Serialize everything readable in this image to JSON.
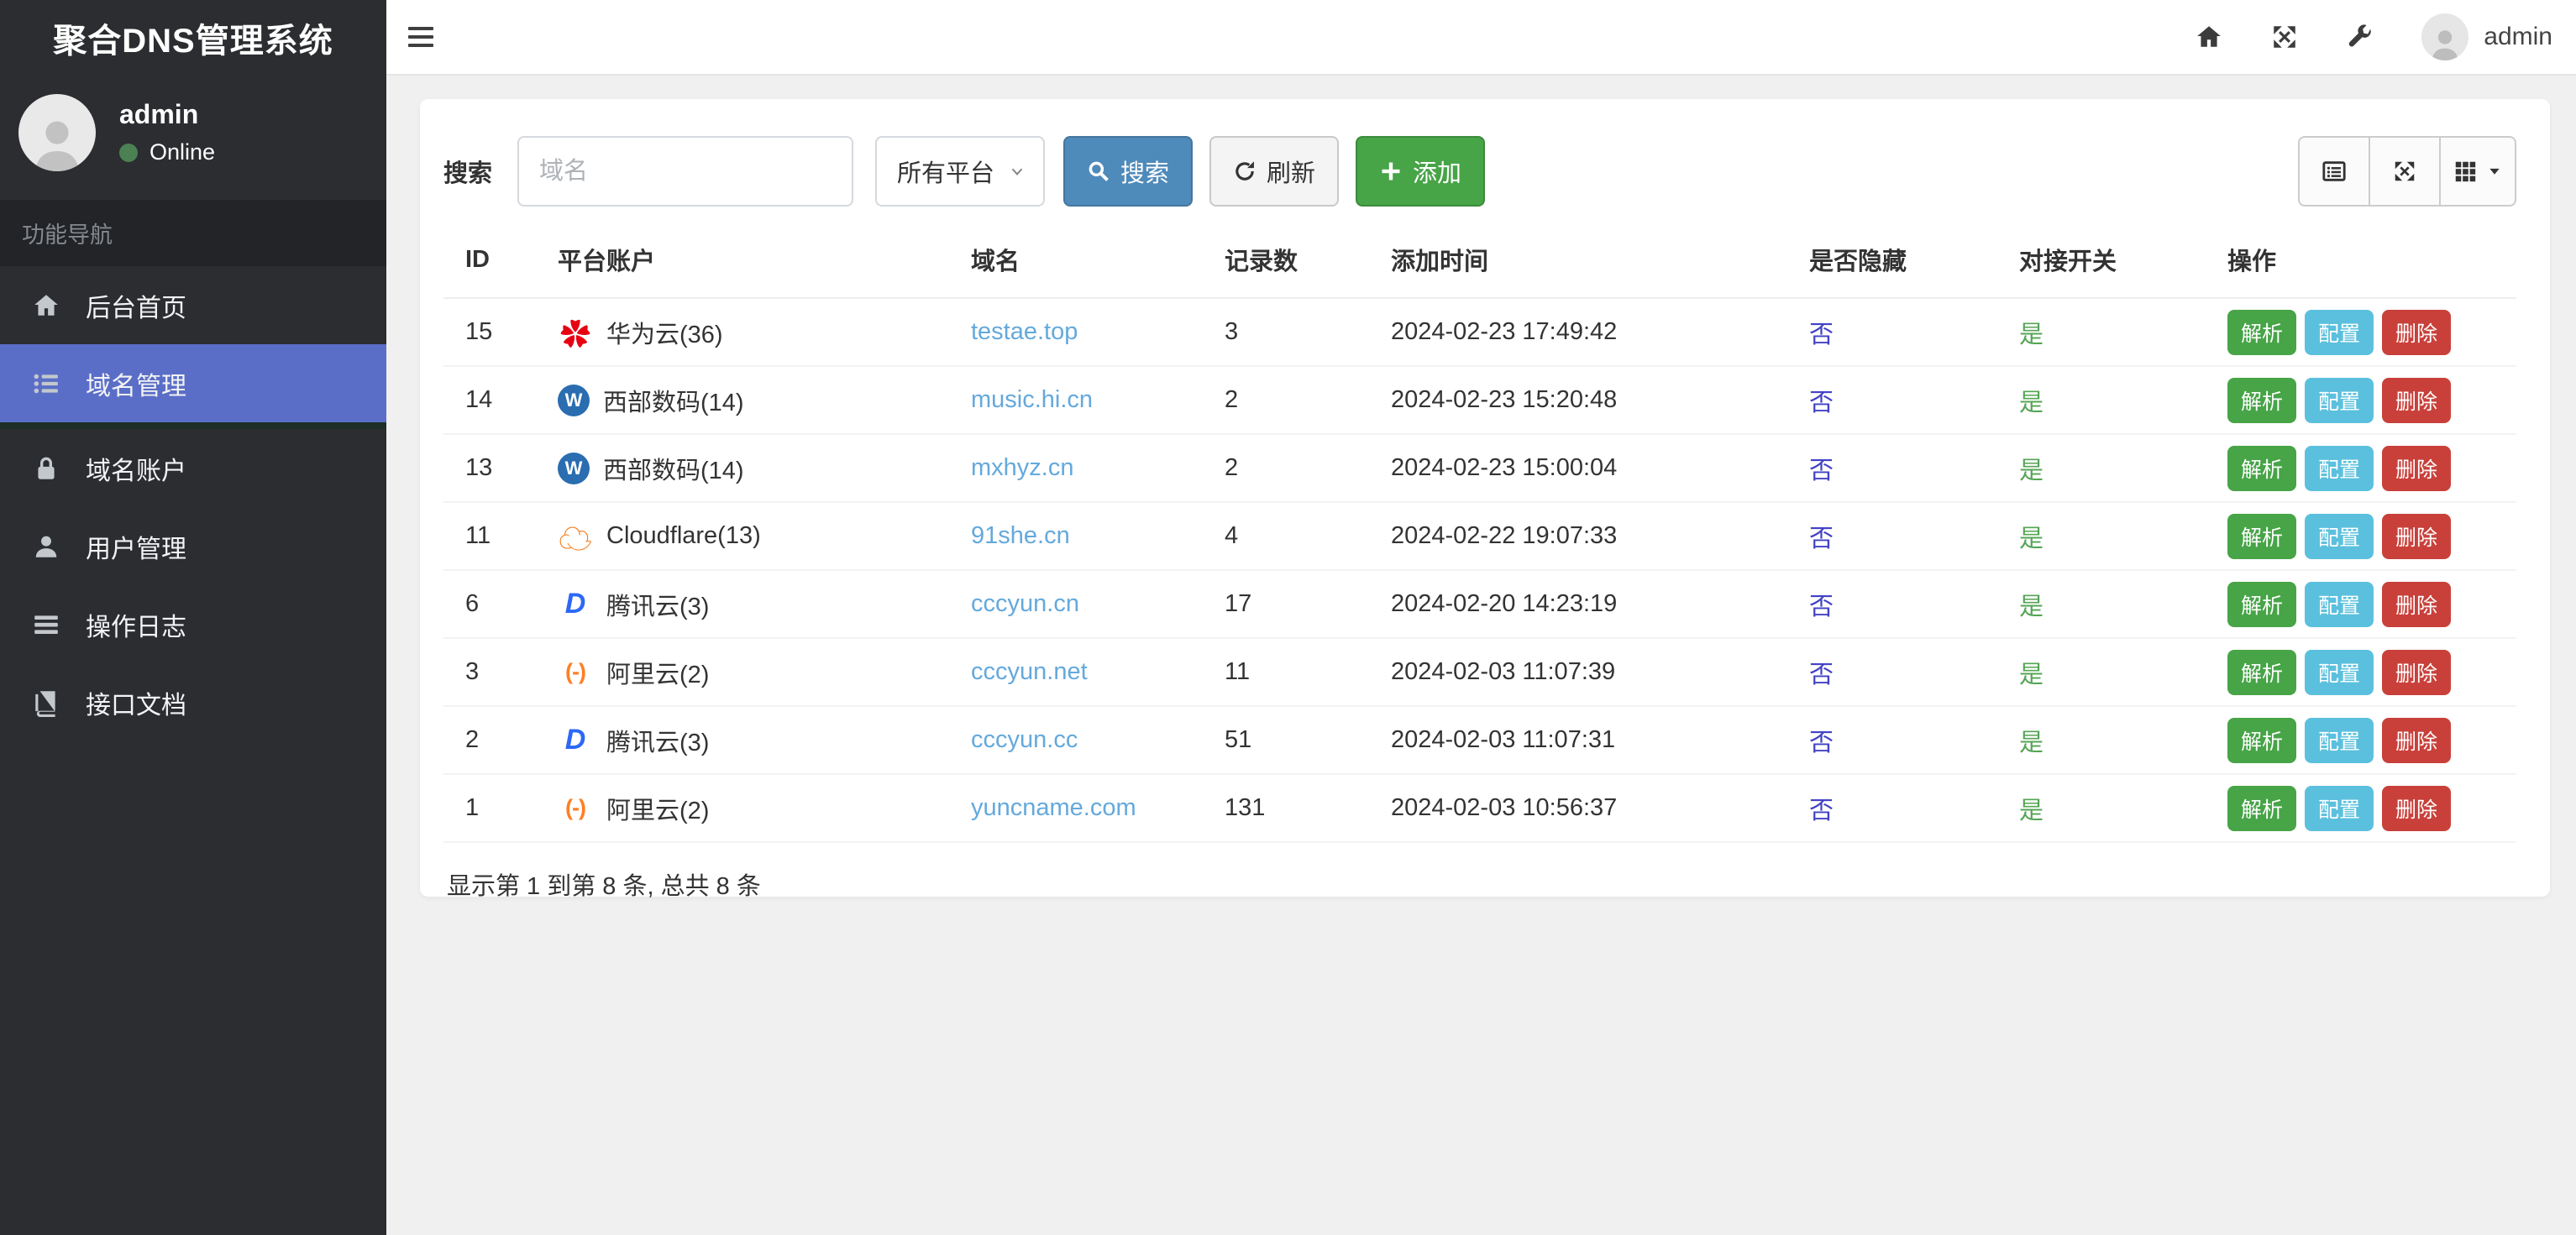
{
  "app": {
    "title": "聚合DNS管理系统"
  },
  "colors": {
    "sidebar_bg": "#2b2d30",
    "sidebar_active": "#5b6ec7",
    "primary_button": "#4e8aba",
    "success_button": "#47a447",
    "info_button": "#5bc0de",
    "danger_button": "#c9403a",
    "domain_link": "#64a9dc",
    "hidden_no_text": "#4141c6",
    "switch_yes_text": "#55a455",
    "online_dot": "#4c8153"
  },
  "sidebar": {
    "user": {
      "name": "admin",
      "status": "Online",
      "avatar_icon": "person-avatar-icon"
    },
    "section_header": "功能导航",
    "items": [
      {
        "label": "后台首页",
        "icon": "home-icon",
        "active": false
      },
      {
        "label": "域名管理",
        "icon": "list-icon",
        "active": true
      },
      {
        "label": "域名账户",
        "icon": "lock-icon",
        "active": false
      },
      {
        "label": "用户管理",
        "icon": "user-icon",
        "active": false
      },
      {
        "label": "操作日志",
        "icon": "log-icon",
        "active": false
      },
      {
        "label": "接口文档",
        "icon": "book-icon",
        "active": false
      }
    ]
  },
  "topbar": {
    "hamburger_icon": "hamburger-icon",
    "right_icons": [
      "home-icon",
      "fullscreen-icon",
      "wrench-icon"
    ],
    "user": "admin"
  },
  "toolbar": {
    "search_label": "搜索",
    "domain_placeholder": "域名",
    "platform_select_value": "所有平台",
    "search_button": "搜索",
    "refresh_button": "刷新",
    "add_button": "添加",
    "view_buttons": [
      "detail-view-icon",
      "fullscreen-icon",
      "columns-icon"
    ]
  },
  "table": {
    "columns": [
      "ID",
      "平台账户",
      "域名",
      "记录数",
      "添加时间",
      "是否隐藏",
      "对接开关",
      "操作"
    ],
    "action_buttons": [
      {
        "label": "解析",
        "color": "#47a447"
      },
      {
        "label": "配置",
        "color": "#5bc0de"
      },
      {
        "label": "删除",
        "color": "#c9403a"
      }
    ],
    "rows": [
      {
        "id": "15",
        "platform": {
          "label": "华为云(36)",
          "icon": "huawei-cloud-icon",
          "glyph": "✿"
        },
        "domain": "testae.top",
        "records": "3",
        "added": "2024-02-23 17:49:42",
        "hidden": "否",
        "switch": "是"
      },
      {
        "id": "14",
        "platform": {
          "label": "西部数码(14)",
          "icon": "west-digital-icon",
          "glyph": "W"
        },
        "domain": "music.hi.cn",
        "records": "2",
        "added": "2024-02-23 15:20:48",
        "hidden": "否",
        "switch": "是"
      },
      {
        "id": "13",
        "platform": {
          "label": "西部数码(14)",
          "icon": "west-digital-icon",
          "glyph": "W"
        },
        "domain": "mxhyz.cn",
        "records": "2",
        "added": "2024-02-23 15:00:04",
        "hidden": "否",
        "switch": "是"
      },
      {
        "id": "11",
        "platform": {
          "label": "Cloudflare(13)",
          "icon": "cloudflare-icon",
          "glyph": "☁"
        },
        "domain": "91she.cn",
        "records": "4",
        "added": "2024-02-22 19:07:33",
        "hidden": "否",
        "switch": "是"
      },
      {
        "id": "6",
        "platform": {
          "label": "腾讯云(3)",
          "icon": "tencent-cloud-icon",
          "glyph": "D"
        },
        "domain": "cccyun.cn",
        "records": "17",
        "added": "2024-02-20 14:23:19",
        "hidden": "否",
        "switch": "是"
      },
      {
        "id": "3",
        "platform": {
          "label": "阿里云(2)",
          "icon": "aliyun-icon",
          "glyph": "(-)"
        },
        "domain": "cccyun.net",
        "records": "11",
        "added": "2024-02-03 11:07:39",
        "hidden": "否",
        "switch": "是"
      },
      {
        "id": "2",
        "platform": {
          "label": "腾讯云(3)",
          "icon": "tencent-cloud-icon",
          "glyph": "D"
        },
        "domain": "cccyun.cc",
        "records": "51",
        "added": "2024-02-03 11:07:31",
        "hidden": "否",
        "switch": "是"
      },
      {
        "id": "1",
        "platform": {
          "label": "阿里云(2)",
          "icon": "aliyun-icon",
          "glyph": "(-)"
        },
        "domain": "yuncname.com",
        "records": "131",
        "added": "2024-02-03 10:56:37",
        "hidden": "否",
        "switch": "是"
      }
    ],
    "summary": "显示第 1 到第 8 条, 总共 8 条"
  }
}
